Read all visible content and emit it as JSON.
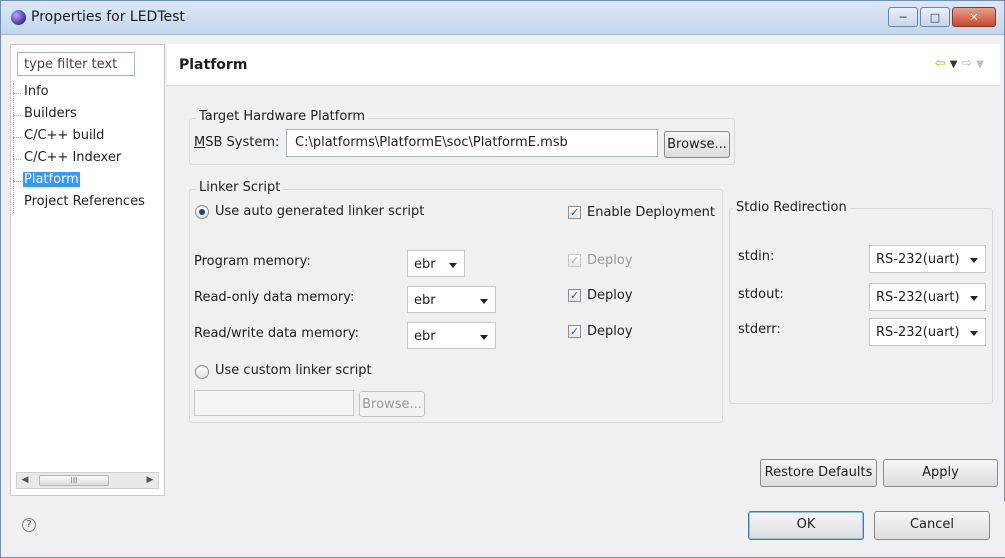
{
  "window": {
    "title": "Properties for LEDTest"
  },
  "filter": {
    "placeholder": "type filter text"
  },
  "tree": {
    "items": [
      {
        "label": "Info"
      },
      {
        "label": "Builders"
      },
      {
        "label": "C/C++ build"
      },
      {
        "label": "C/C++ Indexer"
      },
      {
        "label": "Platform",
        "selected": true
      },
      {
        "label": "Project References"
      }
    ],
    "scroll_grip": "III"
  },
  "page": {
    "title": "Platform"
  },
  "target_hw": {
    "group_label": "Target Hardware Platform",
    "msb_label": "MSB System:",
    "msb_value": "C:\\platforms\\PlatformE\\soc\\PlatformE.msb",
    "browse_label": "Browse..."
  },
  "linker": {
    "group_label": "Linker Script",
    "auto_label": "Use auto generated linker script",
    "enable_deployment_label": "Enable Deployment",
    "rows": [
      {
        "label": "Program memory:",
        "value": "ebr",
        "deploy_label": "Deploy",
        "deploy_checked": true,
        "deploy_enabled": false
      },
      {
        "label": "Read-only data memory:",
        "value": "ebr",
        "deploy_label": "Deploy",
        "deploy_checked": true,
        "deploy_enabled": true
      },
      {
        "label": "Read/write data memory:",
        "value": "ebr",
        "deploy_label": "Deploy",
        "deploy_checked": true,
        "deploy_enabled": true
      }
    ],
    "custom_label": "Use custom linker script",
    "custom_value": "",
    "custom_browse_label": "Browse..."
  },
  "stdio": {
    "group_label": "Stdio Redirection",
    "rows": [
      {
        "label": "stdin:",
        "value": "RS-232(uart)"
      },
      {
        "label": "stdout:",
        "value": "RS-232(uart)"
      },
      {
        "label": "stderr:",
        "value": "RS-232(uart)"
      }
    ]
  },
  "actions": {
    "restore_label": "Restore Defaults",
    "apply_label": "Apply",
    "ok_label": "OK",
    "cancel_label": "Cancel",
    "help_symbol": "?"
  },
  "colors": {
    "selection": "#3399ff",
    "accent": "#3c7fb1"
  }
}
